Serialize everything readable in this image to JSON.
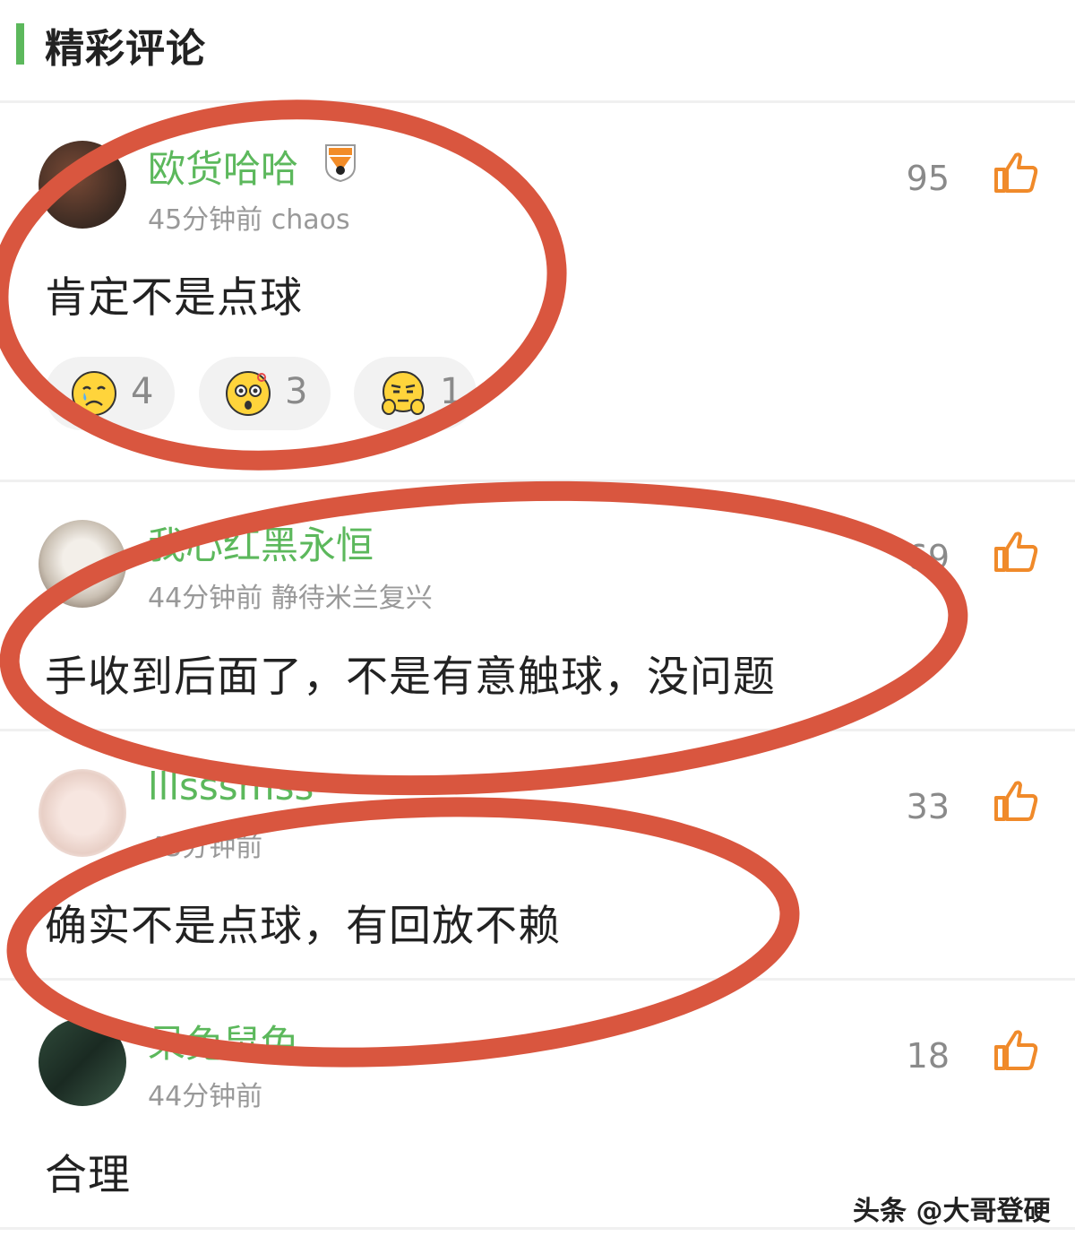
{
  "header": {
    "title": "精彩评论"
  },
  "comments": [
    {
      "username": "欧货哈哈",
      "meta": "45分钟前 chaos",
      "text": "肯定不是点球",
      "likes": "95",
      "reactions": [
        {
          "emoji": "crying-face",
          "count": "4"
        },
        {
          "emoji": "surprised-face",
          "count": "3"
        },
        {
          "emoji": "shrug-face",
          "count": "1"
        }
      ]
    },
    {
      "username": "我心红黑永恒",
      "meta": "44分钟前 静待米兰复兴",
      "text": "手收到后面了，不是有意触球，没问题",
      "likes": "69"
    },
    {
      "username": "lllsssmss",
      "meta": "43分钟前",
      "text": "确实不是点球，有回放不赖",
      "likes": "33"
    },
    {
      "username": "呆兔鼠兔",
      "meta": "44分钟前",
      "text": "合理",
      "likes": "18"
    }
  ],
  "watermark": "头条 @大哥登硬",
  "colors": {
    "accent": "#5cb85c",
    "annotation": "#d9563f",
    "like": "#f08a2a"
  }
}
